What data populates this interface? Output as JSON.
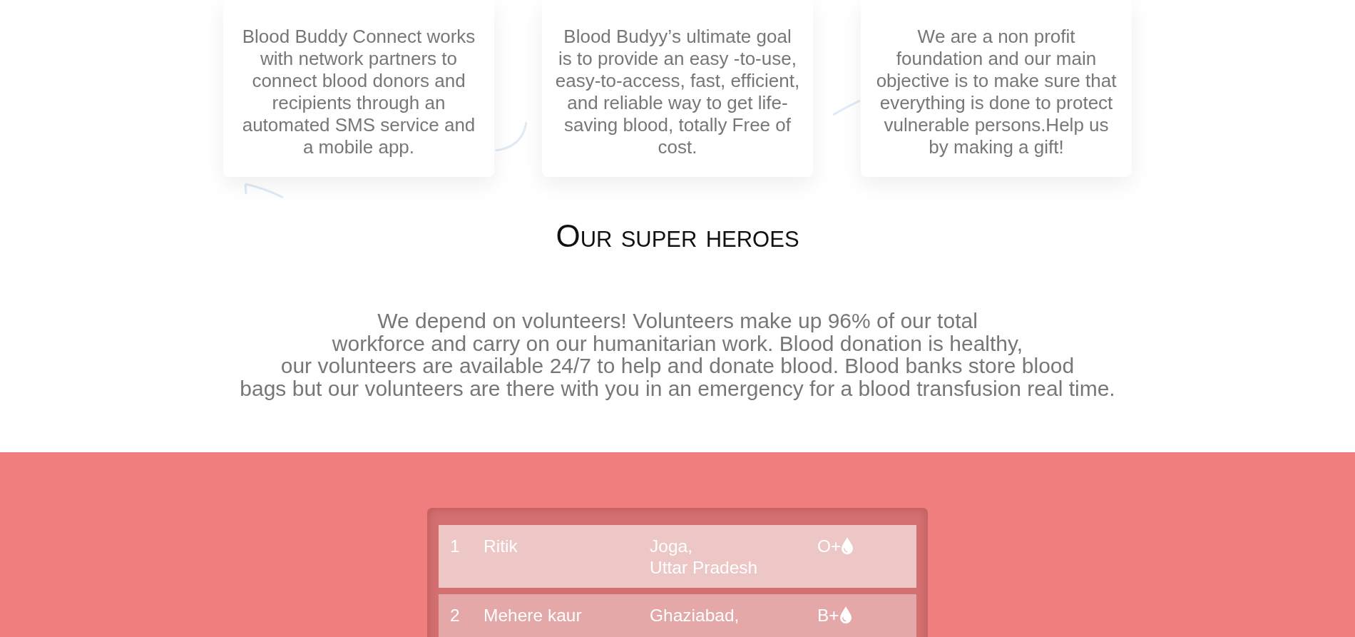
{
  "cards": [
    {
      "text": "Blood Buddy Connect works with network partners to connect blood donors and recipients through an automated SMS service and a mobile app."
    },
    {
      "text": "Blood Budyy’s ultimate goal is to provide an easy -to-use, easy-to-access, fast, efficient, and reliable way to get life-saving blood, totally Free of cost."
    },
    {
      "text": "We are a non profit foundation and our main objective is to make sure that everything is done to protect vulnerable persons.Help us by making a gift!"
    }
  ],
  "heroes": {
    "title": "Our super heroes",
    "intro_lines": [
      "We depend on volunteers! Volunteers make up 96% of our total",
      "workforce and carry on our humanitarian work. Blood donation is healthy,",
      "our volunteers are available 24/7 to help and donate blood. Blood banks store blood",
      "bags but our volunteers are there with you in an emergency for a blood transfusion real time."
    ]
  },
  "donors": {
    "rows": [
      {
        "rank": "1",
        "name": "Ritik",
        "city": "Joga,",
        "state": "Uttar Pradesh",
        "blood_group": "O+"
      },
      {
        "rank": "2",
        "name": "Mehere kaur",
        "city": "Ghaziabad,",
        "blood_group": "B+"
      }
    ]
  }
}
